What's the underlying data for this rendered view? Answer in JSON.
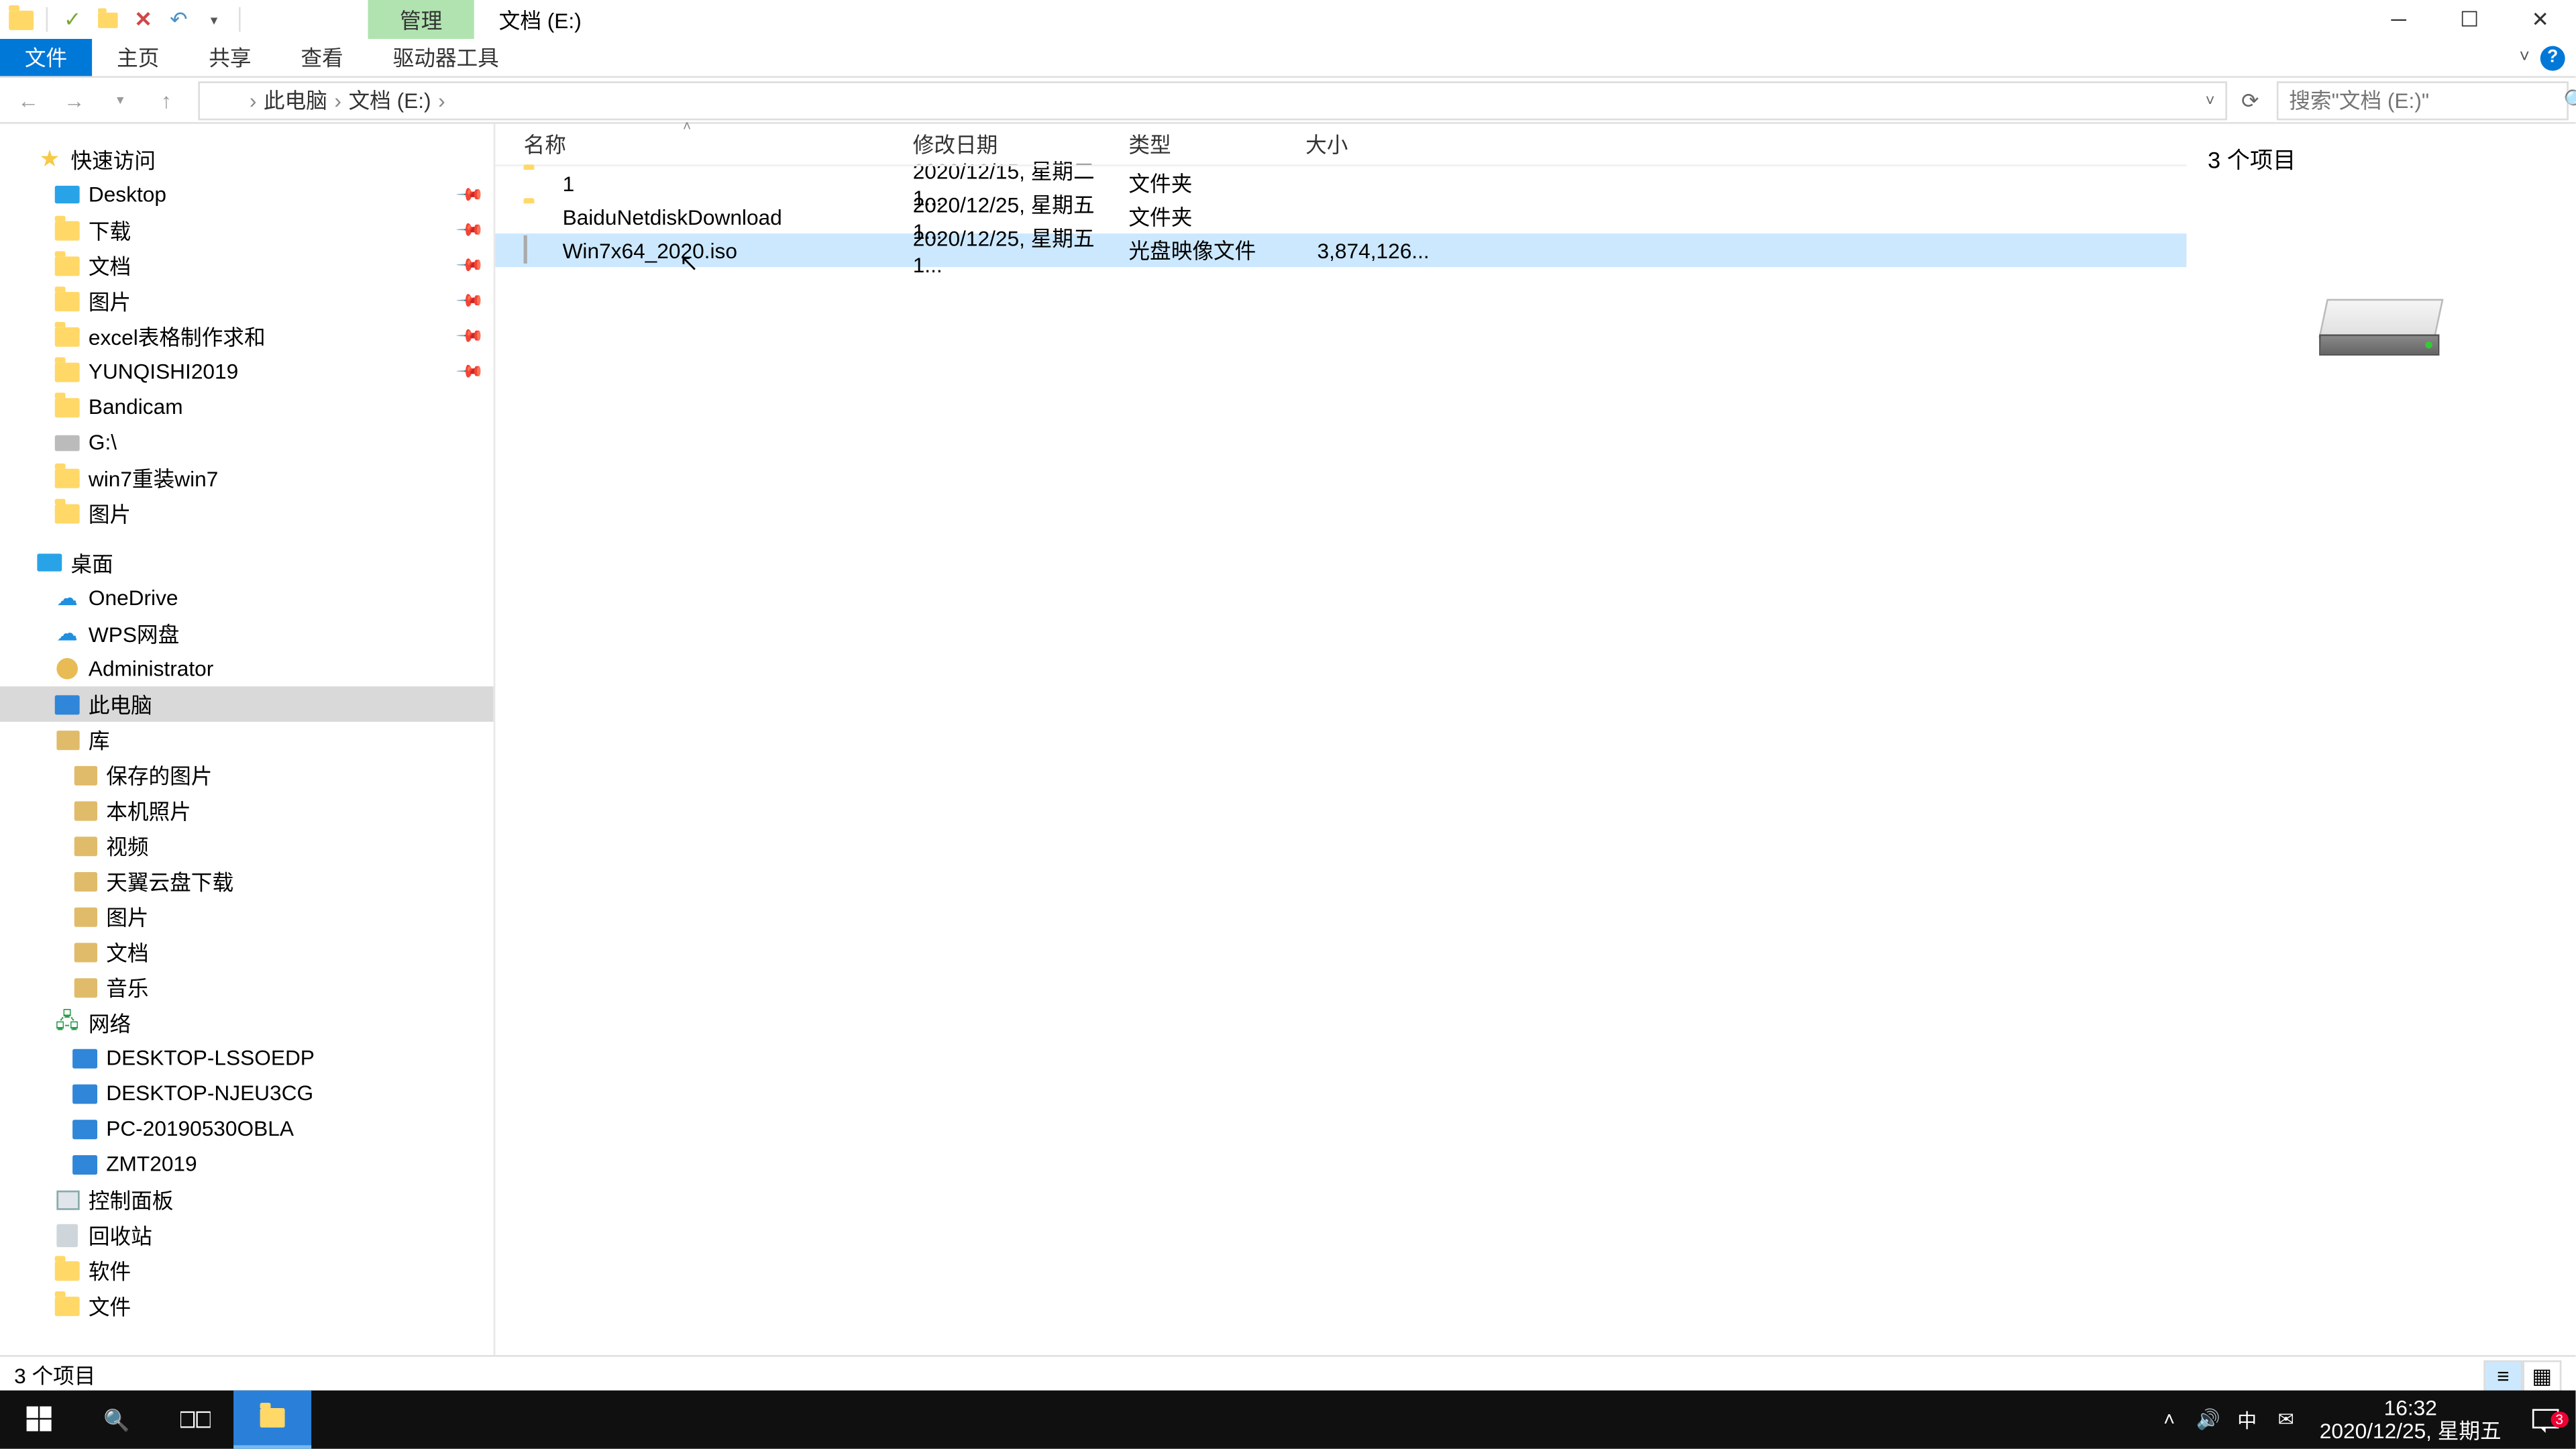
{
  "title": {
    "context_tab": "管理",
    "location": "文档 (E:)"
  },
  "ribbon": {
    "file": "文件",
    "home": "主页",
    "share": "共享",
    "view": "查看",
    "drive_tools": "驱动器工具"
  },
  "breadcrumb": {
    "pc": "此电脑",
    "drive": "文档 (E:)"
  },
  "search": {
    "placeholder": "搜索\"文档 (E:)\""
  },
  "columns": {
    "name": "名称",
    "date": "修改日期",
    "type": "类型",
    "size": "大小"
  },
  "rows": [
    {
      "name": "1",
      "date": "2020/12/15, 星期二 1...",
      "type": "文件夹",
      "size": "",
      "icon": "folder",
      "selected": false
    },
    {
      "name": "BaiduNetdiskDownload",
      "date": "2020/12/25, 星期五 1...",
      "type": "文件夹",
      "size": "",
      "icon": "folder",
      "selected": false
    },
    {
      "name": "Win7x64_2020.iso",
      "date": "2020/12/25, 星期五 1...",
      "type": "光盘映像文件",
      "size": "3,874,126...",
      "icon": "file",
      "selected": true
    }
  ],
  "preview": {
    "summary": "3 个项目"
  },
  "tree": {
    "quick_access": "快速访问",
    "pinned": [
      {
        "label": "Desktop",
        "icon": "desk"
      },
      {
        "label": "下载",
        "icon": "folder"
      },
      {
        "label": "文档",
        "icon": "folder"
      },
      {
        "label": "图片",
        "icon": "folder"
      },
      {
        "label": "excel表格制作求和",
        "icon": "folder"
      },
      {
        "label": "YUNQISHI2019",
        "icon": "folder"
      },
      {
        "label": "Bandicam",
        "icon": "folder"
      },
      {
        "label": "G:\\",
        "icon": "drive"
      },
      {
        "label": "win7重装win7",
        "icon": "folder"
      },
      {
        "label": "图片",
        "icon": "folder"
      }
    ],
    "desktop": "桌面",
    "desktop_children": [
      {
        "label": "OneDrive",
        "icon": "cloud"
      },
      {
        "label": "WPS网盘",
        "icon": "cloud"
      },
      {
        "label": "Administrator",
        "icon": "user"
      },
      {
        "label": "此电脑",
        "icon": "pc",
        "selected": true
      },
      {
        "label": "库",
        "icon": "lib"
      }
    ],
    "lib_children": [
      {
        "label": "保存的图片"
      },
      {
        "label": "本机照片"
      },
      {
        "label": "视频"
      },
      {
        "label": "天翼云盘下载"
      },
      {
        "label": "图片"
      },
      {
        "label": "文档"
      },
      {
        "label": "音乐"
      }
    ],
    "network": "网络",
    "network_children": [
      {
        "label": "DESKTOP-LSSOEDP"
      },
      {
        "label": "DESKTOP-NJEU3CG"
      },
      {
        "label": "PC-20190530OBLA"
      },
      {
        "label": "ZMT2019"
      }
    ],
    "extra": [
      {
        "label": "控制面板",
        "icon": "panel"
      },
      {
        "label": "回收站",
        "icon": "recycle"
      },
      {
        "label": "软件",
        "icon": "folder"
      },
      {
        "label": "文件",
        "icon": "folder"
      }
    ]
  },
  "status": {
    "text": "3 个项目"
  },
  "taskbar": {
    "time": "16:32",
    "date": "2020/12/25, 星期五",
    "ime": "中",
    "badge": "3"
  }
}
